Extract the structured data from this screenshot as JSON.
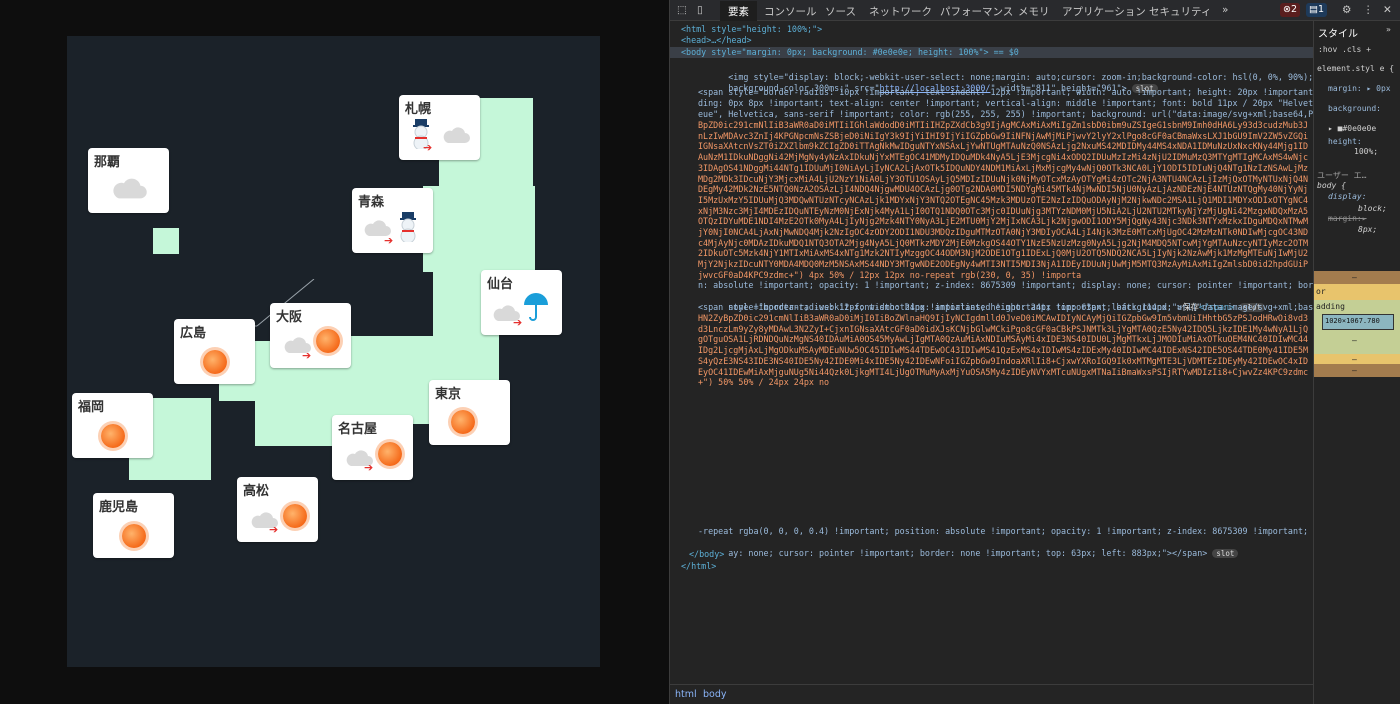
{
  "map": {
    "cities": [
      {
        "name": "札幌",
        "weather": "snow-to-cloudy"
      },
      {
        "name": "那覇",
        "weather": "cloudy"
      },
      {
        "name": "青森",
        "weather": "cloudy-to-snow"
      },
      {
        "name": "仙台",
        "weather": "cloudy-to-rain"
      },
      {
        "name": "大阪",
        "weather": "cloudy-to-sunny"
      },
      {
        "name": "広島",
        "weather": "sunny"
      },
      {
        "name": "東京",
        "weather": "sunny"
      },
      {
        "name": "福岡",
        "weather": "sunny"
      },
      {
        "name": "名古屋",
        "weather": "cloudy-to-sunny"
      },
      {
        "name": "高松",
        "weather": "cloudy-to-sunny"
      },
      {
        "name": "鹿児島",
        "weather": "sunny"
      }
    ],
    "colors": {
      "land": "#c5f7d9",
      "sea": "#1b2229",
      "sun": "#f56a1a",
      "arrow": "#e5312e",
      "umbrella": "#1a9ed9"
    }
  },
  "devtools": {
    "tabs": [
      "要素",
      "コンソール",
      "ソース",
      "ネットワーク",
      "パフォーマンス",
      "メモリ",
      "アプリケーション",
      "セキュリティ",
      "»"
    ],
    "error_count": "2",
    "message_count": "1",
    "side_tabs": [
      "スタイル",
      "»"
    ],
    "filter": ":hov .cls +",
    "lines": {
      "html_open": "<html style=\"height: 100%;\">",
      "head": "<head>…</head>",
      "body_open": "<body style=\"margin: 0px; background: #0e0e0e; height: 100%\"> == $0",
      "img_a": "<img style=\"display: block;-webkit-user-select: none;margin: auto;cursor: zoom-in;background-color: hsl(0, 0%, 90%);transition:",
      "img_b": "background-color 300ms;\" src=\"",
      "img_url": "http://localhost:3000/",
      "img_c": "\" width=\"811\" height=\"961\">",
      "span1_a": "<span style=\"border-radius: 10px !important; text-indent: 12px !important; width: auto !important; height: 20px !important; pad",
      "span1_b": "ding: 0px 8px !important; text-align: center !important; vertical-align: middle !important; font: bold 11px / 20px \"Helvetica N",
      "span1_c": "eue\", Helvetica, sans-serif !important; color: rgb(255, 255, 255) !important; background: url(\"data:image/svg+xml;base64,PHN2Zy",
      "span1_tail_a": "n: absolute !important; opacity: 1 !important; z-index: 8675309 !important; display: none; cursor: pointer !important; border:",
      "span1_tail_b": "none !important; -webkit-font-smoothing: antialiased !important; top: 63px; left: 114px;\">",
      "span1_text": "保存",
      "span2_a": "<span style=\"border-radius: 12px; width: 24px !important; height: 24px !important; background: url(\"data:image/svg+xml;base64,P",
      "span2_tail_a": "-repeat rgba(0, 0, 0, 0.4) !important; position: absolute !important; opacity: 1 !important; z-index: 8675309 !important; displ",
      "span2_tail_b": "ay: none; cursor: pointer !important; border: none !important; top: 63px; left: 883px;\"></span>",
      "body_close": "</body>",
      "html_close": "</html>",
      "slot": "slot",
      "span_close": "</span>",
      "base64_1": "BpZD0ic291cmNlIiB3aWR0aD0iMTIiIGhlaWdodD0iMTIiIHZpZXdCb3g9IjAgMCAxMiAxMiIgZm1sbD0ibm9uZSIgeG1sbnM9Imh0dHA6Ly93d3cudzMub3JnLzIwMDAvc3ZnIj4KPGNpcmNsZSBjeD0iNiIgY3k9IjYiIHI9IjYiIGZpbGw9IiNFNjAwMjMiPjwvY2lyY2xlPgo8cGF0aCBmaWxsLXJ1bGU9ImV2ZW5vZGQiIGNsaXAtcnVsZT0iZXZlbm9kZCIgZD0iTTAgNkMwIDguNTYxNSAxLjYwNTUgMTAuNzQ0NSAzLjg2NxuMS42MDIDMy44MS4xNDA1IDMuNzUxNxcKNy44Mjg1IDAuNzM1IDkuNDggNi42MjMgNy4yNzAxIDkuNjYxMTEgOC41MDMyIDQuMDk4NyA5LjE3MjcgNi4xODQ2IDUuMzIzMi4zNjU2IDMuMzQ3MTYgMTIgMCAxMS4wNjc3IDAgOS41NDggMi44NTg1IDUuMjI0NiAyLjIyNCA2LjAxOTk5IDQuNDY4NDM1MiAxLjMxMjcgMy4wNjQ0OTk3NCA0LjY1ODI5IDIuNjQ4NTg1NzIzNSAwLjMzMDg2MDk3IDcuNjY3MjcxMiA4LjU2NzY1NiA0LjY3OTU1OSAyLjQ5MDIzIDUuNjk0NjMyOTcxMzAyOTYgMi4zOTc2NjA3NTU4NCAzLjIzMjQxOTMyNTUxNjQ4NDEgMy42MDk2NzE5NTQ0NzA2OSAzLjI4NDQ4NjgwMDU4OCAzLjg0OTg2NDA0MDI5NDYgMi45MTk4NjMwNDI5NjU0NyAzLjAzNDEzNjE4NTUzNTQgMy40NjYyNjI5MzUxMzY5IDUuMjQ3MDQwNTUzNTcyNCAzLjk1MDYxNjY3NTQ2OTEgNC45Mzk3MDUzOTE2NzIzIDQuODAyNjM2NjkwNDc2MSA1LjQ1MDI1MDYxODIxOTYgNC4xNjM3Nzc3MjI4MDEzIDQuNTEyNzM0NjExNjk4MyA1LjI0OTQ1NDQ0OTc3Mjc0IDUuNjg3MTYzNDM0MjU5NiA2LjU2NTU2MTkyNjYzMjUgNi42MzgxNDQxMzA5OTQzIDYuMDE1NDI4MzE2OTk0MyA4LjIyNjg2Mzk4NTY0NyA3LjE2MTU0MjY2MjIxNCA3Ljk2NjgwODI1ODY5MjQgNy43Njc3NDk3NTYxMzkxIDguMDQxNTMwMjY0NjI0NCA4LjAxNjMwNDQ4Mjk2NzIgOC4zODY2ODI1NDU3MDQzIDguMTMzOTA0NjY3MDIyOCA4LjI4Njk3MzE0MTcxMjUgOC42MzMzNTk0NDIwMjcgOC43NDc4MjAyNjc0MDAzIDkuMDQ1NTQ3OTA2Mjg4NyA5LjQ0MTkzMDY2MjE0MzkgOS44OTY1NzE5NzUzMzg0NyA5Ljg2NjM4MDQ5NTcwMjYgMTAuNzcyNTIyMzc2OTM2IDkuOTc5Mzk4NjY1MTIxMiAxMS4xNTg1Mzk2NTIyMzggOC44ODM3NjM2ODE1OTg1IDExLjQ0MjU2OTQ5NDQ2NCA5LjIyNjk2NzAwMjk1MzMgMTEuNjIwMjU2MjY2NjkzIDcuNTY0MDA4MDQ0MzM5NSAxMS44NDY3MTgwNDE2ODEgNy4wMTI3NTI5MDI3NjA1IDEyIDUuNjUwMjM5MTQ3MzAyMiAxMiIgZmlsbD0id2hpdGUiPjwvcGF0aD4KPC9zdmc+\") 4px 50% / 12px 12px no-repeat rgb(230, 0, 35) !importa",
      "base64_2": "HN2ZyBpZD0ic291cmNlIiB3aWR0aD0iMjI0IiBoZWlnaHQ9IjIyNCIgdmlld0JveD0iMCAwIDIyNCAyMjQiIGZpbGw9Im5vbmUiIHhtbG5zPSJodHRwOi8vd3d3LnczLm9yZy8yMDAwL3N2ZyI+CjxnIGNsaXAtcGF0aD0idXJsKCNjbGlwMCkiPgo8cGF0aCBkPSJNMTk3LjYgMTA0QzE5Ny42IDQ5LjkzIDE1My4wNyA1LjQgOTguOSA1LjRDNDQuNzMgNS40IDAuMiA0OS45MyAwLjIgMTA0QzAuMiAxNDIuMSAyMi4xIDE3NS40IDU0LjMgMTkxLjJMODIuMiAxOTkuOEM4NC40IDIwMC44IDg2LjcgMjAxLjMgODkuMSAyMDEuNUw5OC45IDIwMS44TDEwOC43IDIwMS41QzExMS4xIDIwMS4zIDExMy40IDIwMC44IDExNS42IDE5OS44TDE0My41IDE5MS4yQzE3NS43IDE3NS40IDE5Ny42IDE0Mi4xIDE5Ny42IDEwNFoiIGZpbGw9IndoaXRlIi8+CjxwYXRoIGQ9Ik0xMTMgMTE3LjVDMTEzIDEyMy42IDEwOC4xIDEyOC41IDEwMiAxMjguNUg5Ni44Qzk0LjkgMTI4LjUgOTMuMyAxMjYuOSA5My4zIDEyNVYxMTcuNUgxMTNaIiBmaWxsPSIjRTYwMDIzIi8+CjwvZz4KPC9zdmc+\") 50% 50% / 24px 24px no"
    },
    "styles": {
      "element_style": "element.styl e {",
      "margin": "margin: ▸ 0px",
      "background": "background:",
      "bg_val": "▸ ■#0e0e0e",
      "height": "height:",
      "height_val": "100%;",
      "ua": "ユーザー エ…",
      "body_rule": "body {",
      "display": "display:",
      "display_val": "block;",
      "margin_ua": "margin:▸",
      "margin_ua_val": "8px;",
      "box_label_1": "or",
      "box_label_2": "adding",
      "box_size": "1020×1067.780",
      "dash": "–"
    },
    "breadcrumbs": [
      "html",
      "body"
    ]
  }
}
